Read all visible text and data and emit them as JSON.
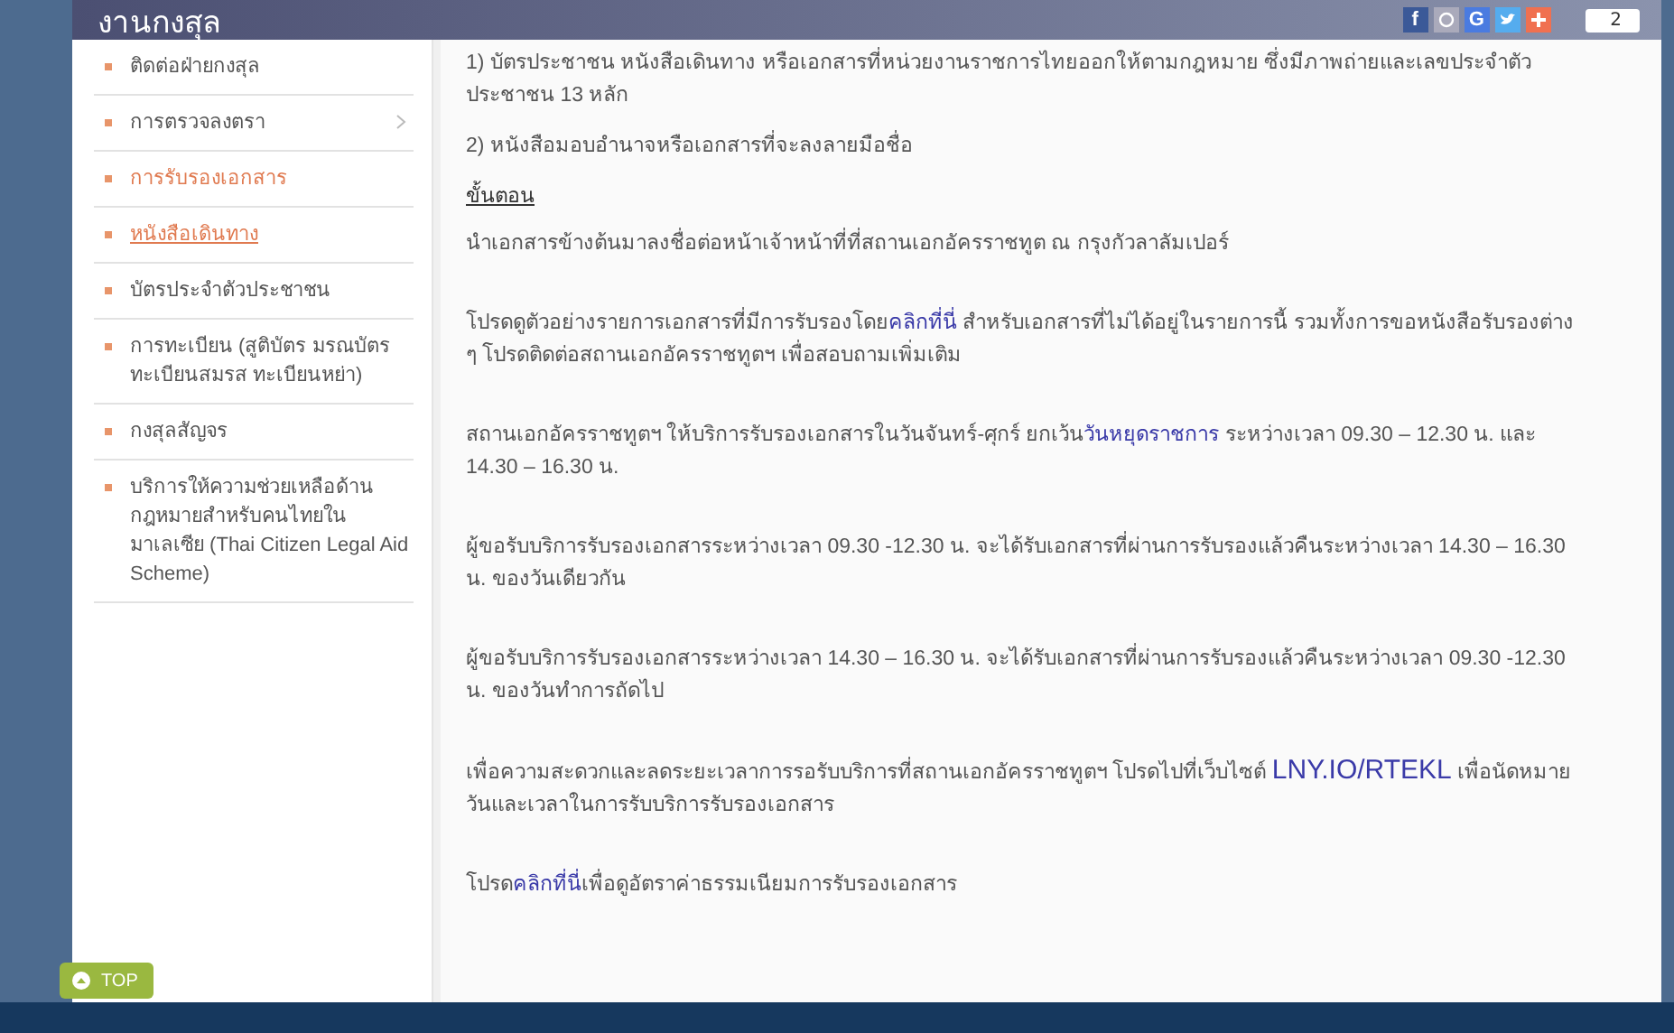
{
  "header": {
    "title": "งานกงสุล",
    "social": [
      {
        "kind": "facebook",
        "label": "f"
      },
      {
        "kind": "pin"
      },
      {
        "kind": "google",
        "label": "G"
      },
      {
        "kind": "twitter"
      },
      {
        "kind": "plus"
      }
    ],
    "share_count": "2"
  },
  "sidebar": {
    "items": [
      {
        "label": "ติดต่อฝ่ายกงสุล",
        "selected": false,
        "expanded": false,
        "submenu": false
      },
      {
        "label": "การตรวจลงตรา",
        "selected": false,
        "expanded": false,
        "submenu": true
      },
      {
        "label": "การรับรองเอกสาร",
        "selected": false,
        "expanded": true,
        "submenu": false
      },
      {
        "label": "หนังสือเดินทาง",
        "selected": true,
        "expanded": false,
        "submenu": false
      },
      {
        "label": "บัตรประจำตัวประชาชน",
        "selected": false,
        "expanded": false,
        "submenu": false
      },
      {
        "label": "การทะเบียน (สูติบัตร มรณบัตร ทะเบียนสมรส ทะเบียนหย่า)",
        "selected": false,
        "expanded": false,
        "submenu": false
      },
      {
        "label": "กงสุลสัญจร",
        "selected": false,
        "expanded": false,
        "submenu": false
      },
      {
        "label": "บริการให้ความช่วยเหลือด้านกฎหมายสำหรับคนไทยในมาเลเซีย (Thai Citizen Legal Aid Scheme)",
        "selected": false,
        "expanded": false,
        "submenu": false
      }
    ]
  },
  "content": [
    {
      "kind": "text",
      "parts": [
        {
          "kind": "text",
          "text": "1) บัตรประชาชน หนังสือเดินทาง หรือเอกสารที่หน่วยงานราชการไทยออกให้ตามกฎหมาย ซึ่งมีภาพถ่ายและเลขประจำตัวประชาชน 13 หลัก"
        }
      ]
    },
    {
      "kind": "text",
      "parts": [
        {
          "kind": "text",
          "text": "2) หนังสือมอบอำนาจหรือเอกสารที่จะลงลายมือชื่อ"
        }
      ]
    },
    {
      "kind": "heading",
      "parts": [
        {
          "kind": "text",
          "text": "ขั้นตอน"
        }
      ]
    },
    {
      "kind": "text",
      "parts": [
        {
          "kind": "text",
          "text": "นำเอกสารข้างต้นมาลงชื่อต่อหน้าเจ้าหน้าที่ที่สถานเอกอัครราชทูต ณ กรุงกัวลาลัมเปอร์"
        }
      ]
    },
    {
      "kind": "spaced",
      "parts": [
        {
          "kind": "text",
          "text": "โปรดดูตัวอย่างรายการเอกสารที่มีการรับรองโดย"
        },
        {
          "kind": "link",
          "text": "คลิกที่นี่"
        },
        {
          "kind": "text",
          "text": "  สำหรับเอกสารที่ไม่ได้อยู่ในรายการนี้ รวมทั้งการขอหนังสือรับรองต่าง ๆ โปรดติดต่อสถานเอกอัครราชทูตฯ เพื่อสอบถามเพิ่มเติม"
        }
      ]
    },
    {
      "kind": "spaced",
      "parts": [
        {
          "kind": "text",
          "text": "สถานเอกอัครราชทูตฯ ให้บริการรับรองเอกสารในวันจันทร์-ศุกร์ ยกเว้น"
        },
        {
          "kind": "link",
          "text": "วันหยุดราชการ"
        },
        {
          "kind": "text",
          "text": " ระหว่างเวลา 09.30 – 12.30 น.  และ 14.30 – 16.30 น."
        }
      ]
    },
    {
      "kind": "spaced",
      "parts": [
        {
          "kind": "text",
          "text": "ผู้ขอรับบริการรับรองเอกสารระหว่างเวลา 09.30 -12.30 น. จะได้รับเอกสารที่ผ่านการรับรองแล้วคืนระหว่างเวลา 14.30 – 16.30 น. ของวันเดียวกัน"
        }
      ]
    },
    {
      "kind": "spaced",
      "parts": [
        {
          "kind": "text",
          "text": "ผู้ขอรับบริการรับรองเอกสารระหว่างเวลา 14.30 – 16.30 น. จะได้รับเอกสารที่ผ่านการรับรองแล้วคืนระหว่างเวลา 09.30 -12.30  น. ของวันทำการถัดไป"
        }
      ]
    },
    {
      "kind": "spaced",
      "parts": [
        {
          "kind": "text",
          "text": "เพื่อความสะดวกและลดระยะเวลาการรอรับบริการที่สถานเอกอัครราชทูตฯ โปรดไปที่เว็บไซต์ "
        },
        {
          "kind": "biglink",
          "text": "LNY.IO/RTEKL"
        },
        {
          "kind": "text",
          "text": " เพื่อนัดหมายวันและเวลาในการรับบริการรับรองเอกสาร"
        }
      ]
    },
    {
      "kind": "spaced",
      "parts": [
        {
          "kind": "text",
          "text": "โปรด"
        },
        {
          "kind": "link",
          "text": "คลิกที่นี่"
        },
        {
          "kind": "text",
          "text": "เพื่อดูอัตราค่าธรรมเนียมการรับรองเอกสาร"
        }
      ]
    }
  ],
  "top_button": {
    "label": "TOP"
  }
}
